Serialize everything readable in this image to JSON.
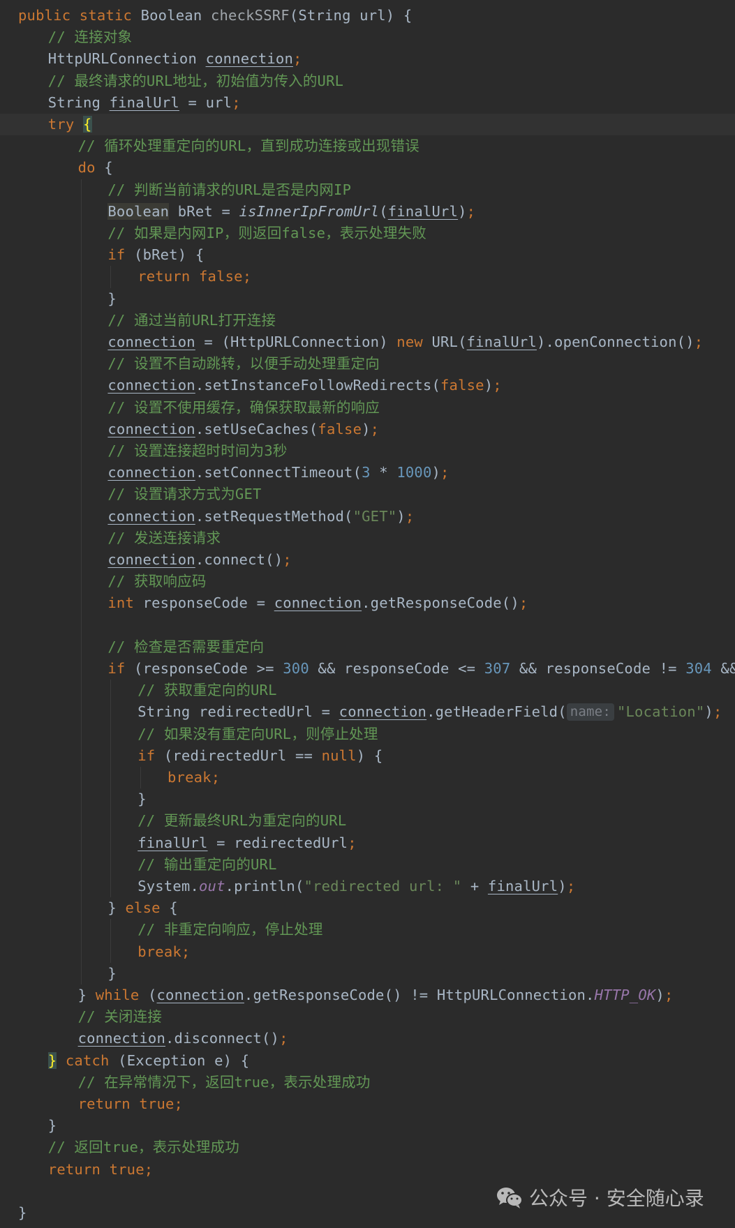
{
  "editor": {
    "language": "Java",
    "theme_colors": {
      "background": "#2b2b2b",
      "current_line": "#323232",
      "keyword": "#cc7832",
      "comment": "#629755",
      "method_declaration": "#ffc66d",
      "number": "#6897bb",
      "string": "#6a8759",
      "static_field": "#9876aa",
      "default_text": "#a9b7c6"
    },
    "lines": [
      {
        "indent": 0,
        "tokens": [
          {
            "t": "kw",
            "v": "public static "
          },
          {
            "t": "",
            "v": "Boolean "
          },
          {
            "t": "dim",
            "v": "checkSSRF"
          },
          {
            "t": "",
            "v": "(String url) {"
          }
        ]
      },
      {
        "indent": 1,
        "tokens": [
          {
            "t": "cm",
            "v": "// 连接对象"
          }
        ]
      },
      {
        "indent": 1,
        "tokens": [
          {
            "t": "",
            "v": "HttpURLConnection "
          },
          {
            "t": "ul",
            "v": "connection"
          },
          {
            "t": "kw",
            "v": ";"
          }
        ]
      },
      {
        "indent": 1,
        "tokens": [
          {
            "t": "cm",
            "v": "// 最终请求的URL地址，初始值为传入的URL"
          }
        ]
      },
      {
        "indent": 1,
        "tokens": [
          {
            "t": "",
            "v": "String "
          },
          {
            "t": "ul",
            "v": "finalUrl"
          },
          {
            "t": "",
            "v": " = url"
          },
          {
            "t": "kw",
            "v": ";"
          }
        ]
      },
      {
        "indent": 1,
        "current": true,
        "tokens": [
          {
            "t": "kw",
            "v": "try "
          },
          {
            "t": "brace",
            "v": "{"
          }
        ]
      },
      {
        "indent": 2,
        "tokens": [
          {
            "t": "cm",
            "v": "// 循环处理重定向的URL，直到成功连接或出现错误"
          }
        ]
      },
      {
        "indent": 2,
        "tokens": [
          {
            "t": "kw",
            "v": "do "
          },
          {
            "t": "",
            "v": "{"
          }
        ]
      },
      {
        "indent": 3,
        "tokens": [
          {
            "t": "cm",
            "v": "// 判断当前请求的URL是否是内网IP"
          }
        ]
      },
      {
        "indent": 3,
        "tokens": [
          {
            "t": "hl",
            "v": "Boolean"
          },
          {
            "t": "",
            "v": " bRet = "
          },
          {
            "t": "it",
            "v": "isInnerIpFromUrl"
          },
          {
            "t": "",
            "v": "("
          },
          {
            "t": "ul",
            "v": "finalUrl"
          },
          {
            "t": "",
            "v": ")"
          },
          {
            "t": "kw",
            "v": ";"
          }
        ]
      },
      {
        "indent": 3,
        "tokens": [
          {
            "t": "cm",
            "v": "// 如果是内网IP，则返回false，表示处理失败"
          }
        ]
      },
      {
        "indent": 3,
        "tokens": [
          {
            "t": "kw",
            "v": "if "
          },
          {
            "t": "",
            "v": "(bRet) {"
          }
        ]
      },
      {
        "indent": 4,
        "tokens": [
          {
            "t": "kw",
            "v": "return false;"
          }
        ]
      },
      {
        "indent": 3,
        "tokens": [
          {
            "t": "",
            "v": "}"
          }
        ]
      },
      {
        "indent": 3,
        "tokens": [
          {
            "t": "cm",
            "v": "// 通过当前URL打开连接"
          }
        ]
      },
      {
        "indent": 3,
        "tokens": [
          {
            "t": "ul",
            "v": "connection"
          },
          {
            "t": "",
            "v": " = (HttpURLConnection) "
          },
          {
            "t": "kw",
            "v": "new "
          },
          {
            "t": "",
            "v": "URL("
          },
          {
            "t": "ul",
            "v": "finalUrl"
          },
          {
            "t": "",
            "v": ").openConnection()"
          },
          {
            "t": "kw",
            "v": ";"
          }
        ]
      },
      {
        "indent": 3,
        "tokens": [
          {
            "t": "cm",
            "v": "// 设置不自动跳转，以便手动处理重定向"
          }
        ]
      },
      {
        "indent": 3,
        "tokens": [
          {
            "t": "ul",
            "v": "connection"
          },
          {
            "t": "",
            "v": ".setInstanceFollowRedirects("
          },
          {
            "t": "kw",
            "v": "false"
          },
          {
            "t": "",
            "v": ")"
          },
          {
            "t": "kw",
            "v": ";"
          }
        ]
      },
      {
        "indent": 3,
        "tokens": [
          {
            "t": "cm",
            "v": "// 设置不使用缓存，确保获取最新的响应"
          }
        ]
      },
      {
        "indent": 3,
        "tokens": [
          {
            "t": "ul",
            "v": "connection"
          },
          {
            "t": "",
            "v": ".setUseCaches("
          },
          {
            "t": "kw",
            "v": "false"
          },
          {
            "t": "",
            "v": ")"
          },
          {
            "t": "kw",
            "v": ";"
          }
        ]
      },
      {
        "indent": 3,
        "tokens": [
          {
            "t": "cm",
            "v": "// 设置连接超时时间为3秒"
          }
        ]
      },
      {
        "indent": 3,
        "tokens": [
          {
            "t": "ul",
            "v": "connection"
          },
          {
            "t": "",
            "v": ".setConnectTimeout("
          },
          {
            "t": "nm",
            "v": "3"
          },
          {
            "t": "",
            "v": " * "
          },
          {
            "t": "nm",
            "v": "1000"
          },
          {
            "t": "",
            "v": ")"
          },
          {
            "t": "kw",
            "v": ";"
          }
        ]
      },
      {
        "indent": 3,
        "tokens": [
          {
            "t": "cm",
            "v": "// 设置请求方式为GET"
          }
        ]
      },
      {
        "indent": 3,
        "tokens": [
          {
            "t": "ul",
            "v": "connection"
          },
          {
            "t": "",
            "v": ".setRequestMethod("
          },
          {
            "t": "st",
            "v": "\"GET\""
          },
          {
            "t": "",
            "v": ")"
          },
          {
            "t": "kw",
            "v": ";"
          }
        ]
      },
      {
        "indent": 3,
        "tokens": [
          {
            "t": "cm",
            "v": "// 发送连接请求"
          }
        ]
      },
      {
        "indent": 3,
        "tokens": [
          {
            "t": "ul",
            "v": "connection"
          },
          {
            "t": "",
            "v": ".connect()"
          },
          {
            "t": "kw",
            "v": ";"
          }
        ]
      },
      {
        "indent": 3,
        "tokens": [
          {
            "t": "cm",
            "v": "// 获取响应码"
          }
        ]
      },
      {
        "indent": 3,
        "tokens": [
          {
            "t": "kw",
            "v": "int "
          },
          {
            "t": "",
            "v": "responseCode = "
          },
          {
            "t": "ul",
            "v": "connection"
          },
          {
            "t": "",
            "v": ".getResponseCode()"
          },
          {
            "t": "kw",
            "v": ";"
          }
        ]
      },
      {
        "indent": 3,
        "tokens": []
      },
      {
        "indent": 3,
        "tokens": [
          {
            "t": "cm",
            "v": "// 检查是否需要重定向"
          }
        ]
      },
      {
        "indent": 3,
        "tokens": [
          {
            "t": "kw",
            "v": "if "
          },
          {
            "t": "",
            "v": "(responseCode >= "
          },
          {
            "t": "nm",
            "v": "300"
          },
          {
            "t": "",
            "v": " && responseCode <= "
          },
          {
            "t": "nm",
            "v": "307"
          },
          {
            "t": "",
            "v": " && responseCode != "
          },
          {
            "t": "nm",
            "v": "304"
          },
          {
            "t": "",
            "v": " && r"
          }
        ]
      },
      {
        "indent": 4,
        "tokens": [
          {
            "t": "cm",
            "v": "// 获取重定向的URL"
          }
        ]
      },
      {
        "indent": 4,
        "tokens": [
          {
            "t": "",
            "v": "String redirectedUrl = "
          },
          {
            "t": "ul",
            "v": "connection"
          },
          {
            "t": "",
            "v": ".getHeaderField("
          },
          {
            "t": "hint",
            "v": "name:"
          },
          {
            "t": "st",
            "v": "\"Location\""
          },
          {
            "t": "",
            "v": ")"
          },
          {
            "t": "kw",
            "v": ";"
          }
        ]
      },
      {
        "indent": 4,
        "tokens": [
          {
            "t": "cm",
            "v": "// 如果没有重定向URL，则停止处理"
          }
        ]
      },
      {
        "indent": 4,
        "tokens": [
          {
            "t": "kw",
            "v": "if "
          },
          {
            "t": "",
            "v": "(redirectedUrl == "
          },
          {
            "t": "kw",
            "v": "null"
          },
          {
            "t": "",
            "v": ") {"
          }
        ]
      },
      {
        "indent": 5,
        "tokens": [
          {
            "t": "kw",
            "v": "break;"
          }
        ]
      },
      {
        "indent": 4,
        "tokens": [
          {
            "t": "",
            "v": "}"
          }
        ]
      },
      {
        "indent": 4,
        "tokens": [
          {
            "t": "cm",
            "v": "// 更新最终URL为重定向的URL"
          }
        ]
      },
      {
        "indent": 4,
        "tokens": [
          {
            "t": "ul",
            "v": "finalUrl"
          },
          {
            "t": "",
            "v": " = redirectedUrl"
          },
          {
            "t": "kw",
            "v": ";"
          }
        ]
      },
      {
        "indent": 4,
        "tokens": [
          {
            "t": "cm",
            "v": "// 输出重定向的URL"
          }
        ]
      },
      {
        "indent": 4,
        "tokens": [
          {
            "t": "",
            "v": "System."
          },
          {
            "t": "fd",
            "v": "out"
          },
          {
            "t": "",
            "v": ".println("
          },
          {
            "t": "st",
            "v": "\"redirected url: \""
          },
          {
            "t": "",
            "v": " + "
          },
          {
            "t": "ul",
            "v": "finalUrl"
          },
          {
            "t": "",
            "v": ")"
          },
          {
            "t": "kw",
            "v": ";"
          }
        ]
      },
      {
        "indent": 3,
        "tokens": [
          {
            "t": "",
            "v": "} "
          },
          {
            "t": "kw",
            "v": "else "
          },
          {
            "t": "",
            "v": "{"
          }
        ]
      },
      {
        "indent": 4,
        "tokens": [
          {
            "t": "cm",
            "v": "// 非重定向响应，停止处理"
          }
        ]
      },
      {
        "indent": 4,
        "tokens": [
          {
            "t": "kw",
            "v": "break;"
          }
        ]
      },
      {
        "indent": 3,
        "tokens": [
          {
            "t": "",
            "v": "}"
          }
        ]
      },
      {
        "indent": 2,
        "tokens": [
          {
            "t": "",
            "v": "} "
          },
          {
            "t": "kw",
            "v": "while "
          },
          {
            "t": "",
            "v": "("
          },
          {
            "t": "ul",
            "v": "connection"
          },
          {
            "t": "",
            "v": ".getResponseCode() != HttpURLConnection."
          },
          {
            "t": "fd",
            "v": "HTTP_OK"
          },
          {
            "t": "",
            "v": ")"
          },
          {
            "t": "kw",
            "v": ";"
          }
        ]
      },
      {
        "indent": 2,
        "tokens": [
          {
            "t": "cm",
            "v": "// 关闭连接"
          }
        ]
      },
      {
        "indent": 2,
        "tokens": [
          {
            "t": "ul",
            "v": "connection"
          },
          {
            "t": "",
            "v": ".disconnect()"
          },
          {
            "t": "kw",
            "v": ";"
          }
        ]
      },
      {
        "indent": 1,
        "tokens": [
          {
            "t": "brace",
            "v": "}"
          },
          {
            "t": "",
            "v": " "
          },
          {
            "t": "kw",
            "v": "catch "
          },
          {
            "t": "",
            "v": "(Exception e) {"
          }
        ]
      },
      {
        "indent": 2,
        "tokens": [
          {
            "t": "cm",
            "v": "// 在异常情况下，返回true，表示处理成功"
          }
        ]
      },
      {
        "indent": 2,
        "tokens": [
          {
            "t": "kw",
            "v": "return true;"
          }
        ]
      },
      {
        "indent": 1,
        "tokens": [
          {
            "t": "",
            "v": "}"
          }
        ]
      },
      {
        "indent": 1,
        "tokens": [
          {
            "t": "cm",
            "v": "// 返回true，表示处理成功"
          }
        ]
      },
      {
        "indent": 1,
        "tokens": [
          {
            "t": "kw",
            "v": "return true;"
          }
        ]
      },
      {
        "indent": 0,
        "tokens": []
      },
      {
        "indent": 0,
        "tokens": [
          {
            "t": "",
            "v": "}"
          }
        ]
      }
    ]
  },
  "watermark": {
    "icon": "wechat-icon",
    "text": "公众号 · 安全随心录"
  }
}
